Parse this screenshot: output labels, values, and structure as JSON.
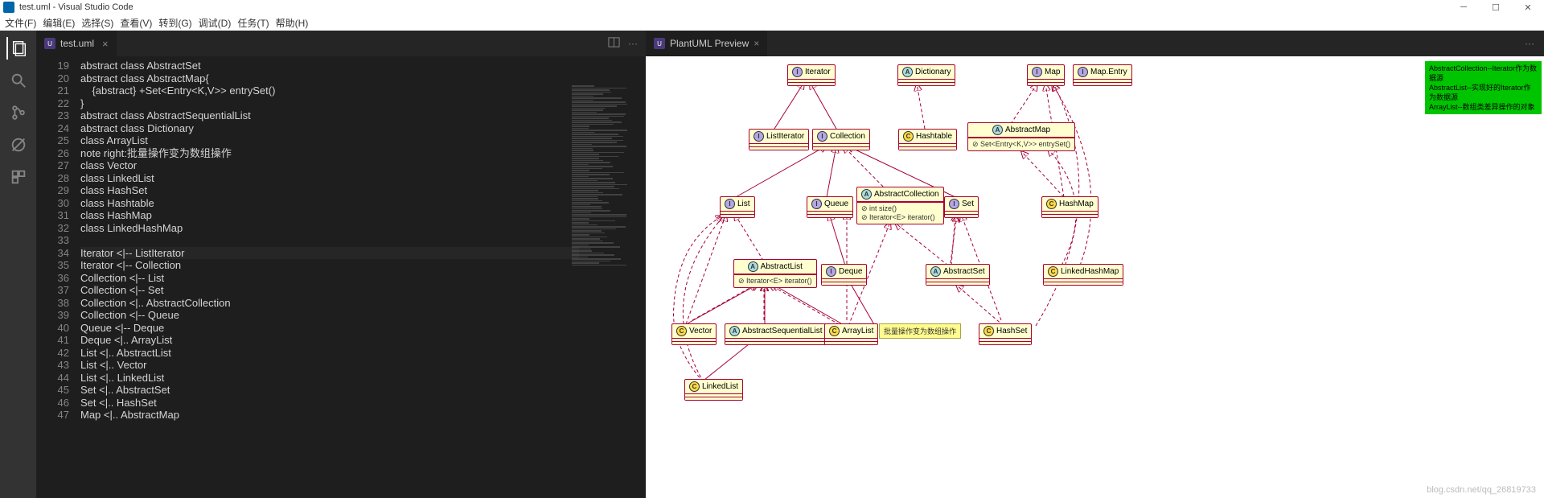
{
  "window": {
    "title": "test.uml - Visual Studio Code"
  },
  "menu": {
    "file": "文件(F)",
    "edit": "编辑(E)",
    "select": "选择(S)",
    "view": "查看(V)",
    "goto": "转到(G)",
    "debug": "调试(D)",
    "task": "任务(T)",
    "help": "帮助(H)"
  },
  "tab": {
    "filename": "test.uml",
    "icon_initial": "U"
  },
  "preview_tab": {
    "title": "PlantUML Preview",
    "icon_initial": "U"
  },
  "gutter_start": 19,
  "code_lines": [
    "abstract class AbstractSet",
    "abstract class AbstractMap{",
    "    {abstract} +Set<Entry<K,V>> entrySet()",
    "}",
    "abstract class AbstractSequentialList",
    "abstract class Dictionary",
    "class ArrayList",
    "note right:批量操作变为数组操作",
    "class Vector",
    "class LinkedList",
    "class HashSet",
    "class Hashtable",
    "class HashMap",
    "class LinkedHashMap",
    "",
    "Iterator <|-- ListIterator",
    "Iterator <|-- Collection",
    "Collection <|-- List",
    "Collection <|-- Set",
    "Collection <|.. AbstractCollection",
    "Collection <|-- Queue",
    "Queue <|-- Deque",
    "Deque <|.. ArrayList",
    "List <|.. AbstractList",
    "List <|.. Vector",
    "List <|.. LinkedList",
    "Set <|.. AbstractSet",
    "Set <|.. HashSet",
    "Map <|.. AbstractMap"
  ],
  "uml": {
    "Iterator": "Iterator",
    "Dictionary": "Dictionary",
    "Map": "Map",
    "MapEntry": "Map.Entry",
    "ListIterator": "ListIterator",
    "Collection": "Collection",
    "Hashtable": "Hashtable",
    "AbstractMap": "AbstractMap",
    "AbstractMap_attr": "⊘ Set<Entry<K,V>> entrySet()",
    "List": "List",
    "Queue": "Queue",
    "AbstractCollection": "AbstractCollection",
    "AbstractCollection_a1": "⊘ int size()",
    "AbstractCollection_a2": "⊘ Iterator<E> iterator()",
    "Set": "Set",
    "HashMap": "HashMap",
    "AbstractList": "AbstractList",
    "AbstractList_attr": "⊘ Iterator<E> iterator()",
    "Deque": "Deque",
    "AbstractSet": "AbstractSet",
    "LinkedHashMap": "LinkedHashMap",
    "Vector": "Vector",
    "AbstractSequentialList": "AbstractSequentialList",
    "ArrayList": "ArrayList",
    "HashSet": "HashSet",
    "LinkedList": "LinkedList",
    "note_arraylist": "批量操作变为数组操作",
    "green_l1": "AbstractCollection--Iterator作为数据源",
    "green_l2": "AbstractList--实现好的Iterator作为数据源",
    "green_l3": "ArrayList--数组类差异操作的对象"
  },
  "watermark": "blog.csdn.net/qq_26819733"
}
